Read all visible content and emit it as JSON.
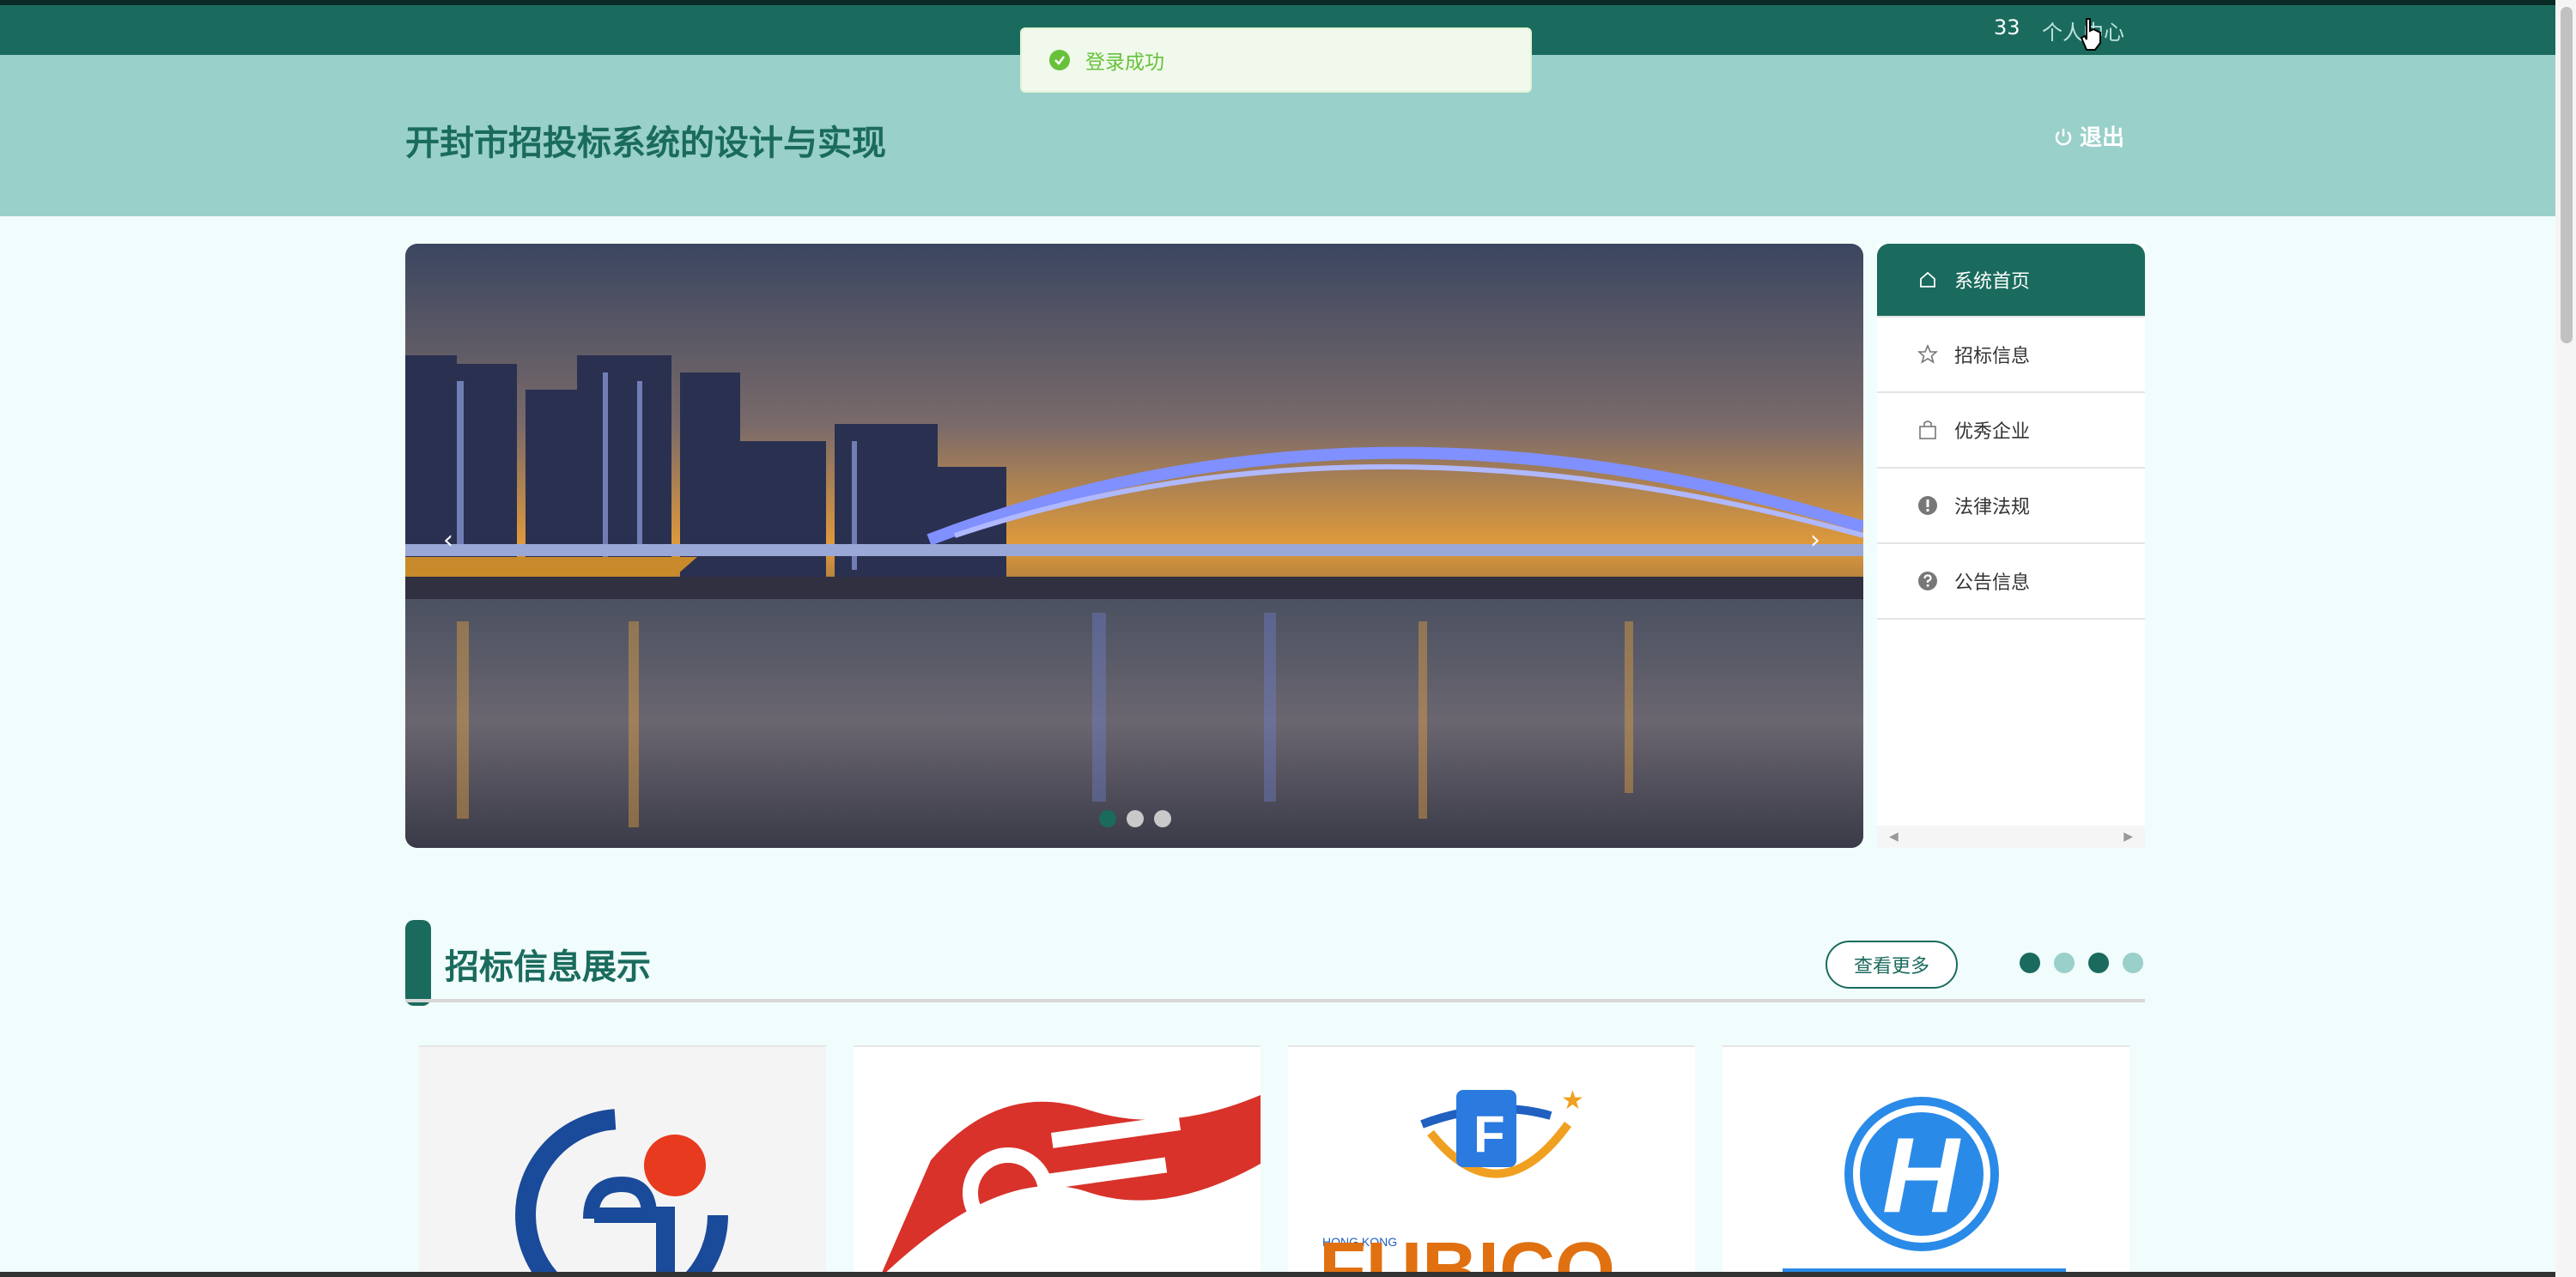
{
  "topbar": {
    "user_count": "33",
    "user_center": "个人中心"
  },
  "toast": {
    "message": "登录成功"
  },
  "header": {
    "title": "开封市招投标系统的设计与实现",
    "logout": "退出"
  },
  "sidebar": {
    "items": [
      {
        "label": "系统首页",
        "icon": "home-icon",
        "active": true
      },
      {
        "label": "招标信息",
        "icon": "star-icon",
        "active": false
      },
      {
        "label": "优秀企业",
        "icon": "bag-icon",
        "active": false
      },
      {
        "label": "法律法规",
        "icon": "info-icon",
        "active": false
      },
      {
        "label": "公告信息",
        "icon": "question-icon",
        "active": false
      }
    ]
  },
  "carousel": {
    "slide_count": 3,
    "active_index": 0
  },
  "section": {
    "title": "招标信息展示",
    "more_button": "查看更多",
    "dot_colors": [
      "#1a6b5d",
      "#99d0c9",
      "#1a6b5d",
      "#99d0c9"
    ]
  },
  "cards": [
    {
      "logo": "ei-logo"
    },
    {
      "logo": "red-flag-logo"
    },
    {
      "logo": "hong-kong-fubico-logo"
    },
    {
      "logo": "h-circle-logo"
    }
  ],
  "colors": {
    "primary": "#1a6b5d",
    "header_bg": "#99d0c9",
    "page_bg": "#f1fcfc",
    "toast_green": "#67c23a"
  }
}
